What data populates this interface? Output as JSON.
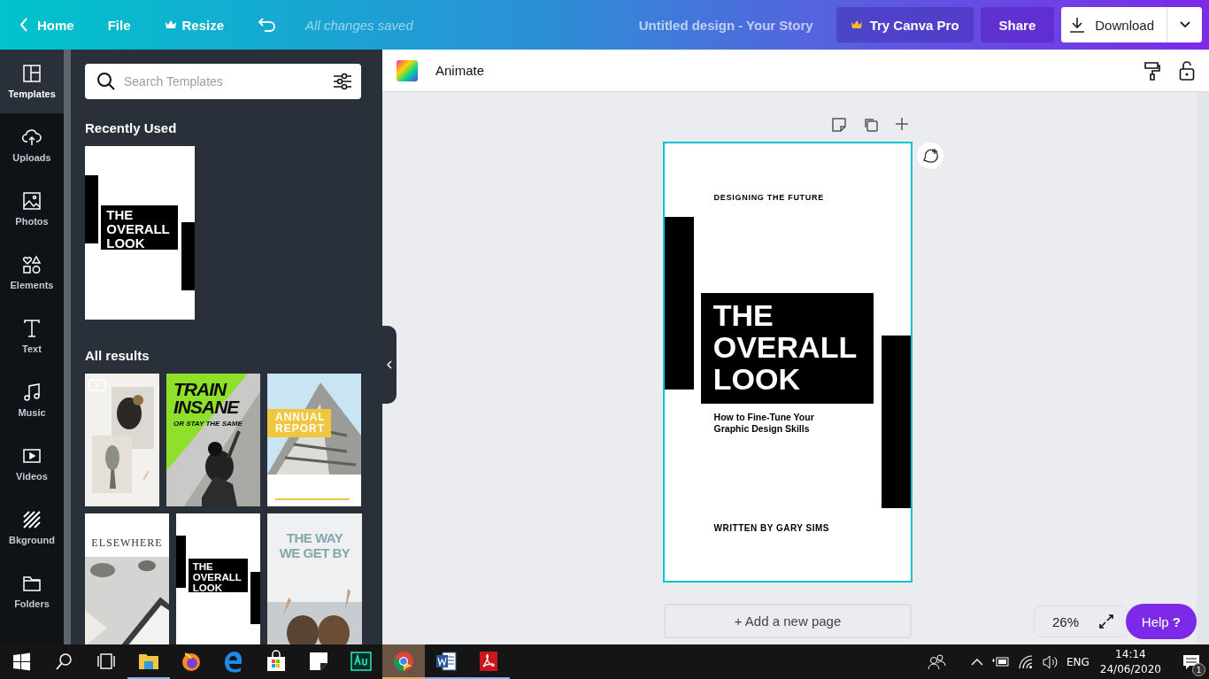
{
  "topbar": {
    "home": "Home",
    "file": "File",
    "resize": "Resize",
    "status": "All changes saved",
    "title": "Untitled design - Your Story",
    "pro": "Try Canva Pro",
    "share": "Share",
    "download": "Download"
  },
  "rail": [
    {
      "kind": "templates",
      "label": "Templates",
      "selected": true
    },
    {
      "kind": "uploads",
      "label": "Uploads",
      "selected": false
    },
    {
      "kind": "photos",
      "label": "Photos",
      "selected": false
    },
    {
      "kind": "elements",
      "label": "Elements",
      "selected": false
    },
    {
      "kind": "text",
      "label": "Text",
      "selected": false
    },
    {
      "kind": "music",
      "label": "Music",
      "selected": false
    },
    {
      "kind": "videos",
      "label": "Videos",
      "selected": false
    },
    {
      "kind": "background",
      "label": "Bkground",
      "selected": false
    },
    {
      "kind": "folders",
      "label": "Folders",
      "selected": false
    }
  ],
  "panel": {
    "search_placeholder": "Search Templates",
    "recent_heading": "Recently Used",
    "recent": [
      {
        "kind": "overall",
        "title": "THE\nOVERALL\nLOOK"
      }
    ],
    "results_heading": "All results",
    "results": [
      [
        {
          "kind": "collage"
        },
        {
          "kind": "train",
          "title": "TRAIN\nINSANE",
          "subtitle": "OR STAY THE SAME"
        },
        {
          "kind": "annual",
          "title": "ANNUAL\nREPORT"
        }
      ],
      [
        {
          "kind": "elsewhere",
          "title": "ELSEWHERE"
        },
        {
          "kind": "overall",
          "title": "THE\nOVERALL\nLOOK"
        },
        {
          "kind": "way",
          "title": "THE WAY\nWE GET BY"
        }
      ]
    ]
  },
  "editor": {
    "animate": "Animate",
    "selected": true,
    "design": {
      "kind": "overall",
      "top": "DESIGNING THE FUTURE",
      "title": "THE\nOVERALL\nLOOK",
      "subtitle": "How to Fine-Tune Your\nGraphic Design Skills",
      "byline": "WRITTEN BY GARY SIMS"
    },
    "add_page": "+ Add a new page",
    "zoom": "26%",
    "help": "Help",
    "help_mark": "?"
  },
  "taskbar": {
    "apps": [
      {
        "kind": "explorer",
        "running": true,
        "selected": false
      },
      {
        "kind": "firefox",
        "running": false,
        "selected": false
      },
      {
        "kind": "edge",
        "running": false,
        "selected": false
      },
      {
        "kind": "store",
        "running": false,
        "selected": false
      },
      {
        "kind": "sticky",
        "running": false,
        "selected": false
      },
      {
        "kind": "audition",
        "running": false,
        "selected": false
      },
      {
        "kind": "chrome",
        "running": true,
        "selected": true
      },
      {
        "kind": "word",
        "running": true,
        "selected": false
      },
      {
        "kind": "acrobat",
        "running": true,
        "selected": false
      }
    ],
    "lang": "ENG",
    "time": "14:14",
    "date": "24/06/2020",
    "notifications": "1"
  }
}
